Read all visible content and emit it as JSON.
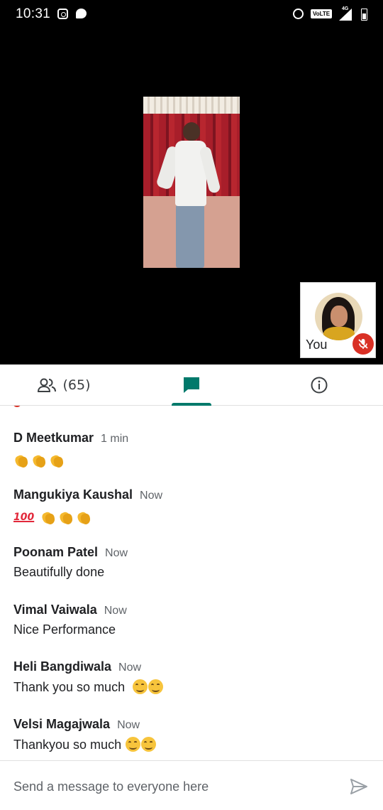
{
  "status_bar": {
    "time": "10:31",
    "network_badge": "VoLTE",
    "network_type": "4G",
    "icons": [
      "instagram-icon",
      "messenger-icon",
      "alarm-icon",
      "signal-icon",
      "battery-icon"
    ]
  },
  "self_tile": {
    "label": "You",
    "mic_state": "muted"
  },
  "tabs": {
    "people_count": "(65)",
    "active": "chat"
  },
  "messages": [
    {
      "sender": "D Meetkumar",
      "time": "1 min",
      "text": "👏👏👏"
    },
    {
      "sender": "Mangukiya Kaushal",
      "time": "Now",
      "text": "💯👏👏👏"
    },
    {
      "sender": "Poonam Patel",
      "time": "Now",
      "text": "Beautifully done"
    },
    {
      "sender": "Vimal Vaiwala",
      "time": "Now",
      "text": "Nice Performance"
    },
    {
      "sender": "Heli Bangdiwala",
      "time": "Now",
      "text": "Thank you so much"
    },
    {
      "sender": "Velsi Magajwala",
      "time": "Now",
      "text": "Thankyou so much"
    }
  ],
  "composer": {
    "placeholder": "Send a message to everyone here"
  },
  "colors": {
    "accent": "#00796b",
    "mic_off": "#d93025",
    "video_bg": "#000000"
  }
}
